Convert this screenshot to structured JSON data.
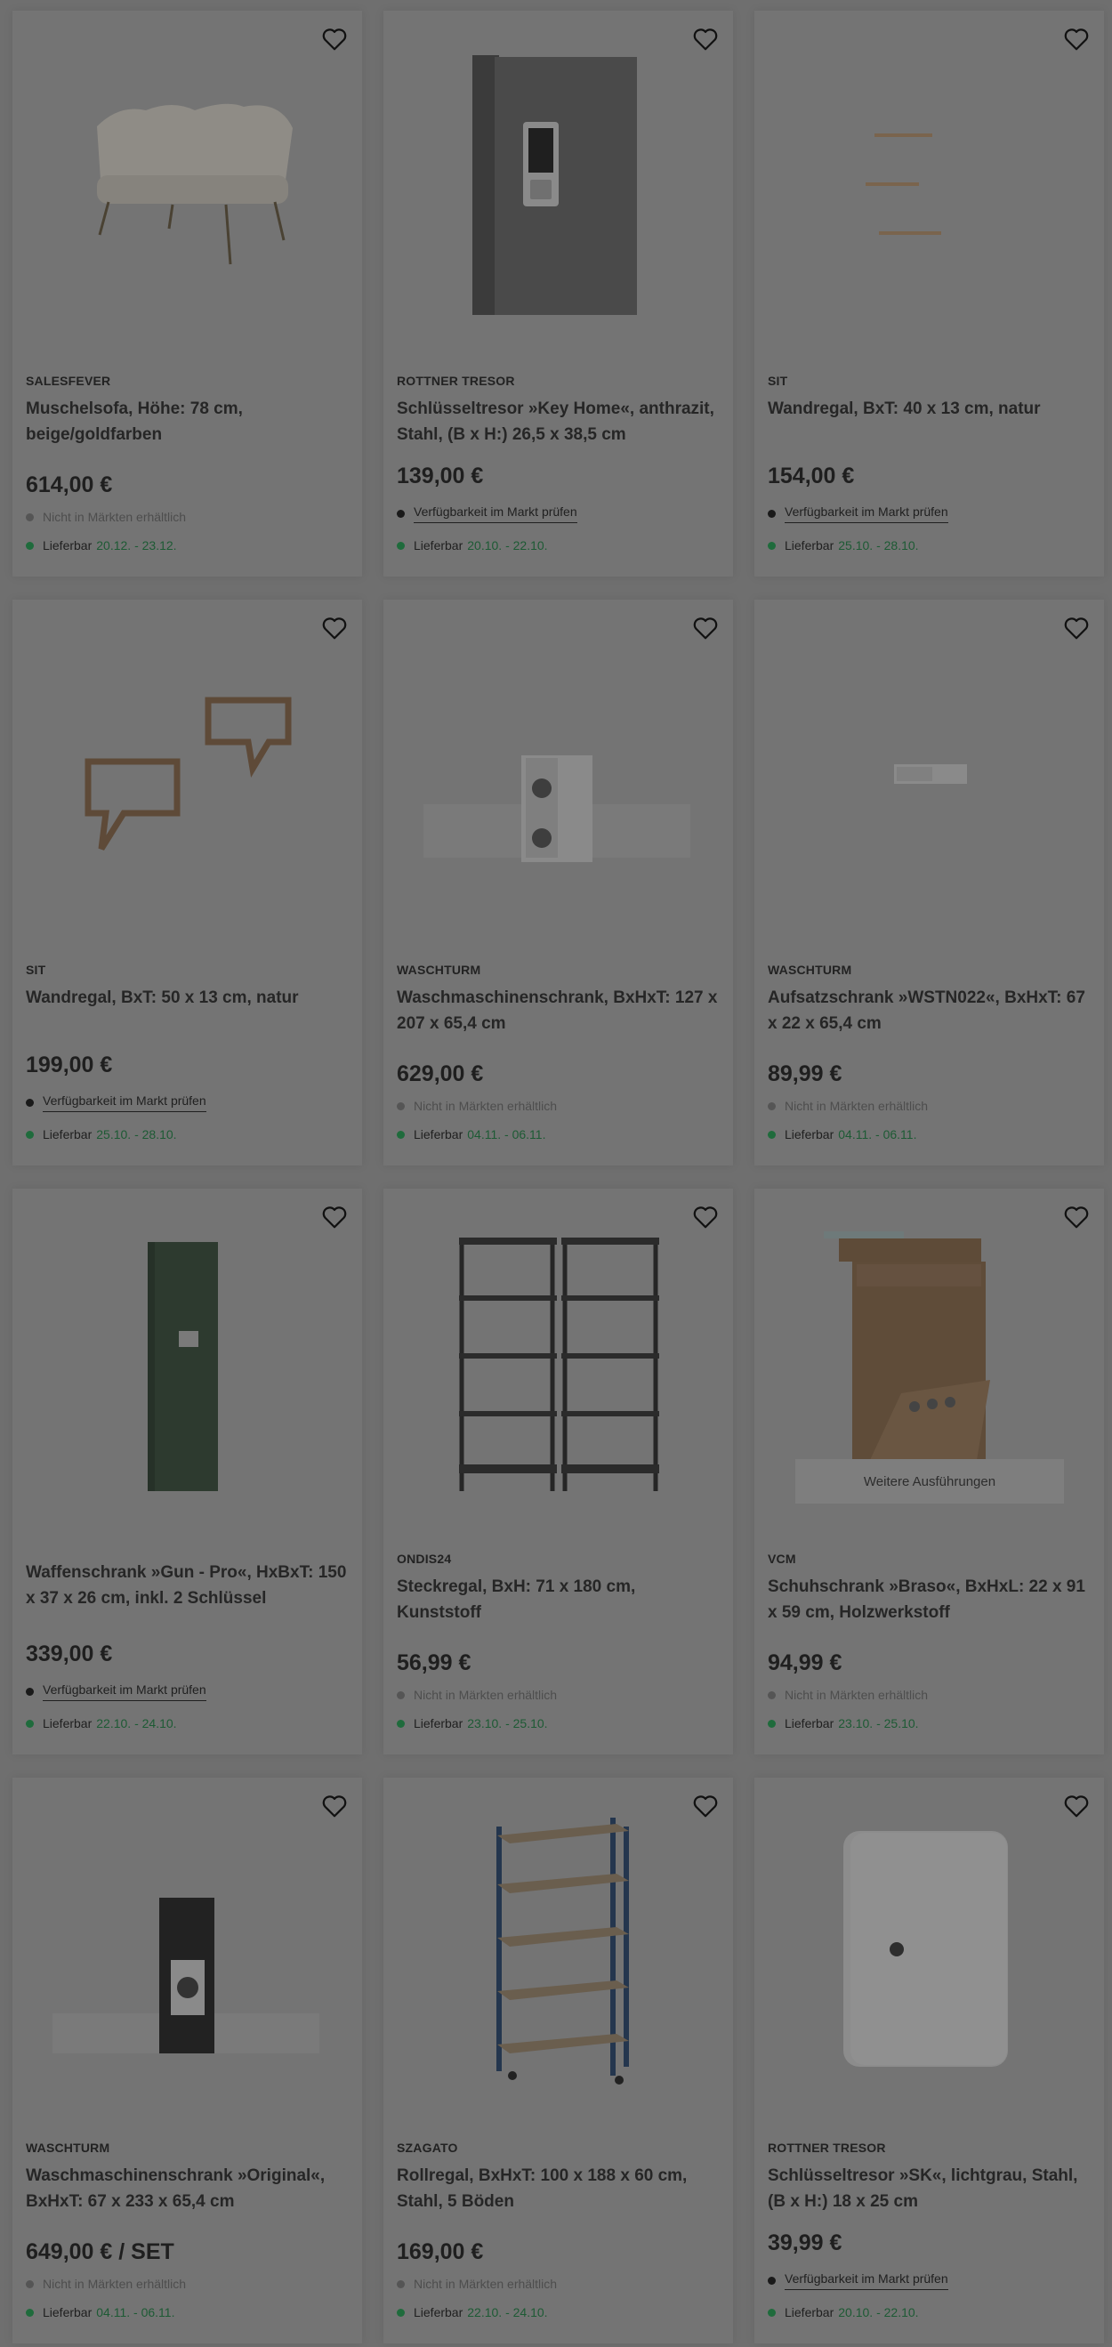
{
  "colors": {
    "background": "#6f6f6f",
    "card": "#747474",
    "delivery_date": "#1d5a34",
    "delivery_dot": "#1f6b3c"
  },
  "icons": {
    "favorite": "heart-outline-icon"
  },
  "labels": {
    "delivery": "Lieferbar"
  },
  "products": [
    {
      "brand": "SALESFEVER",
      "name": "Muschelsofa, Höhe: 78 cm, beige/goldfarben",
      "price": "614,00 €",
      "availability": "Nicht in Märkten erhältlich",
      "availability_type": "na",
      "delivery": "20.12. - 23.12."
    },
    {
      "brand": "ROTTNER TRESOR",
      "name": "Schlüsseltresor »Key Home«, anthrazit, Stahl, (B x H:) 26,5 x 38,5 cm",
      "price": "139,00 €",
      "availability": "Verfügbarkeit im Markt prüfen",
      "availability_type": "market",
      "delivery": "20.10. - 22.10."
    },
    {
      "brand": "SIT",
      "name": "Wandregal, BxT: 40 x 13 cm, natur",
      "price": "154,00 €",
      "availability": "Verfügbarkeit im Markt prüfen",
      "availability_type": "market",
      "delivery": "25.10. - 28.10."
    },
    {
      "brand": "SIT",
      "name": "Wandregal, BxT: 50 x 13 cm, natur",
      "price": "199,00 €",
      "availability": "Verfügbarkeit im Markt prüfen",
      "availability_type": "market",
      "delivery": "25.10. - 28.10."
    },
    {
      "brand": "WASCHTURM",
      "name": "Waschmaschinenschrank, BxHxT: 127 x 207 x 65,4 cm",
      "price": "629,00 €",
      "availability": "Nicht in Märkten erhältlich",
      "availability_type": "na",
      "delivery": "04.11. - 06.11."
    },
    {
      "brand": "WASCHTURM",
      "name": "Aufsatzschrank »WSTN022«, BxHxT: 67 x 22 x 65,4 cm",
      "price": "89,99 €",
      "availability": "Nicht in Märkten erhältlich",
      "availability_type": "na",
      "delivery": "04.11. - 06.11."
    },
    {
      "brand": "",
      "name": "Waffenschrank »Gun - Pro«, HxBxT: 150 x 37 x 26 cm, inkl. 2 Schlüssel",
      "price": "339,00 €",
      "availability": "Verfügbarkeit im Markt prüfen",
      "availability_type": "market",
      "delivery": "22.10. - 24.10."
    },
    {
      "brand": "ONDIS24",
      "name": "Steckregal, BxH: 71 x 180 cm, Kunststoff",
      "price": "56,99 €",
      "availability": "Nicht in Märkten erhältlich",
      "availability_type": "na",
      "delivery": "23.10. - 25.10."
    },
    {
      "brand": "VCM",
      "name": "Schuhschrank »Braso«, BxHxL: 22 x 91 x 59 cm, Holzwerkstoff",
      "price": "94,99 €",
      "availability": "Nicht in Märkten erhältlich",
      "availability_type": "na",
      "delivery": "23.10. - 25.10.",
      "more_variants": "Weitere Ausführungen"
    },
    {
      "brand": "WASCHTURM",
      "name": "Waschmaschinenschrank »Original«, BxHxT: 67 x 233 x 65,4 cm",
      "price": "649,00 € / SET",
      "availability": "Nicht in Märkten erhältlich",
      "availability_type": "na",
      "delivery": "04.11. - 06.11."
    },
    {
      "brand": "SZAGATO",
      "name": "Rollregal, BxHxT: 100 x 188 x 60 cm, Stahl, 5 Böden",
      "price": "169,00 €",
      "availability": "Nicht in Märkten erhältlich",
      "availability_type": "na",
      "delivery": "22.10. - 24.10."
    },
    {
      "brand": "ROTTNER TRESOR",
      "name": "Schlüsseltresor »SK«, lichtgrau, Stahl, (B x H:) 18 x 25 cm",
      "price": "39,99 €",
      "availability": "Verfügbarkeit im Markt prüfen",
      "availability_type": "market",
      "delivery": "20.10. - 22.10."
    }
  ]
}
